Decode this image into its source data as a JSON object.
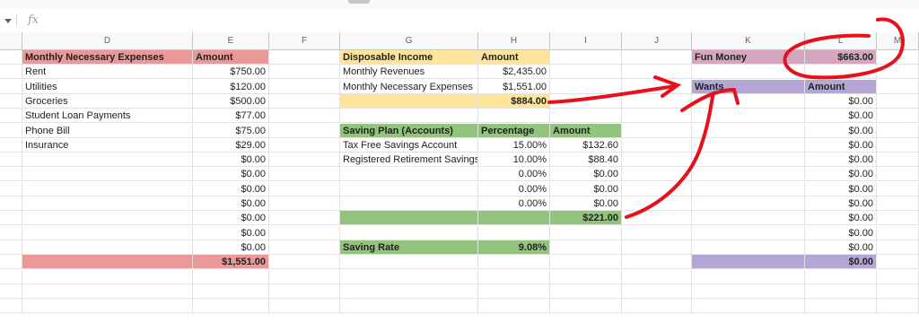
{
  "formula_bar": {
    "fx_label": "fx",
    "value": ""
  },
  "columns": [
    "D",
    "E",
    "F",
    "G",
    "H",
    "I",
    "J",
    "K",
    "L",
    "M"
  ],
  "expenses": {
    "header": "Monthly Necessary Expenses",
    "amount_header": "Amount",
    "items": [
      {
        "label": "Rent",
        "amount": "$750.00"
      },
      {
        "label": "Utilities",
        "amount": "$120.00"
      },
      {
        "label": "Groceries",
        "amount": "$500.00"
      },
      {
        "label": "Student Loan Payments",
        "amount": "$77.00"
      },
      {
        "label": "Phone Bill",
        "amount": "$75.00"
      },
      {
        "label": "Insurance",
        "amount": "$29.00"
      },
      {
        "label": "",
        "amount": "$0.00"
      },
      {
        "label": "",
        "amount": "$0.00"
      },
      {
        "label": "",
        "amount": "$0.00"
      },
      {
        "label": "",
        "amount": "$0.00"
      },
      {
        "label": "",
        "amount": "$0.00"
      },
      {
        "label": "",
        "amount": "$0.00"
      },
      {
        "label": "",
        "amount": "$0.00"
      }
    ],
    "total": "$1,551.00"
  },
  "disposable": {
    "header": "Disposable Income",
    "amount_header": "Amount",
    "rows": [
      {
        "label": "Monthly Revenues",
        "amount": "$2,435.00"
      },
      {
        "label": "Monthly Necessary Expenses",
        "amount": "$1,551.00"
      }
    ],
    "total": "$884.00"
  },
  "saving_plan": {
    "header": "Saving Plan (Accounts)",
    "pct_header": "Percentage",
    "amount_header": "Amount",
    "rows": [
      {
        "label": "Tax Free Savings Account",
        "pct": "15.00%",
        "amount": "$132.60"
      },
      {
        "label": "Registered Retirement Savings",
        "pct": "10.00%",
        "amount": "$88.40"
      },
      {
        "label": "",
        "pct": "0.00%",
        "amount": "$0.00"
      },
      {
        "label": "",
        "pct": "0.00%",
        "amount": "$0.00"
      },
      {
        "label": "",
        "pct": "0.00%",
        "amount": "$0.00"
      }
    ],
    "total": "$221.00"
  },
  "saving_rate": {
    "label": "Saving Rate",
    "value": "9.08%"
  },
  "fun_money": {
    "label": "Fun Money",
    "value": "$663.00"
  },
  "wants": {
    "header": "Wants",
    "amount_header": "Amount",
    "rows": [
      {
        "label": "",
        "amount": "$0.00"
      },
      {
        "label": "",
        "amount": "$0.00"
      },
      {
        "label": "",
        "amount": "$0.00"
      },
      {
        "label": "",
        "amount": "$0.00"
      },
      {
        "label": "",
        "amount": "$0.00"
      },
      {
        "label": "",
        "amount": "$0.00"
      },
      {
        "label": "",
        "amount": "$0.00"
      },
      {
        "label": "",
        "amount": "$0.00"
      },
      {
        "label": "",
        "amount": "$0.00"
      },
      {
        "label": "",
        "amount": "$0.00"
      },
      {
        "label": "",
        "amount": "$0.00"
      }
    ],
    "total": "$0.00"
  },
  "colors": {
    "expenses": "#ea9999",
    "disposable": "#ffe599",
    "saving": "#93c47d",
    "fun_money": "#d5a6bd",
    "wants": "#b4a7d6",
    "annotation": "#e8101a"
  }
}
